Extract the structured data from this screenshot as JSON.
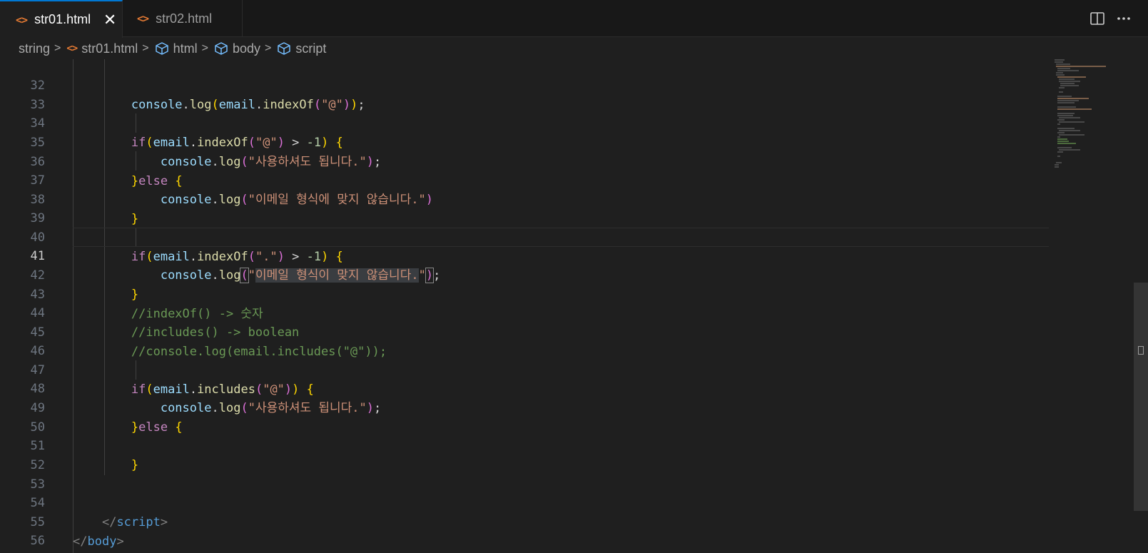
{
  "tabs": [
    {
      "label": "str01.html",
      "icon": "html-file-icon",
      "active": true
    },
    {
      "label": "str02.html",
      "icon": "html-file-icon",
      "active": false
    }
  ],
  "tab_icon_glyph": "<>",
  "close_glyph": "✕",
  "breadcrumb": {
    "folder": "string",
    "file": "str01.html",
    "symbols": [
      "html",
      "body",
      "script"
    ]
  },
  "editor": {
    "current_line": 41,
    "line_numbers": [
      32,
      33,
      34,
      35,
      36,
      37,
      38,
      39,
      40,
      41,
      42,
      43,
      44,
      45,
      46,
      47,
      48,
      49,
      50,
      51,
      52,
      53,
      54,
      55,
      56
    ],
    "strings": {
      "at": "\"@\"",
      "dot": "\".\"",
      "ok_msg": "\"사용하셔도 됩니다.\"",
      "err_msg_1": "\"이메일 형식에 맞지 않습니다.\"",
      "err_msg_2_open": "\"",
      "err_msg_2_body": "이메일 형식이 맞지 않습니다.",
      "err_msg_2_close": "\"",
      "neg_one": "-1"
    },
    "comments": {
      "c43": "//indexOf() -> 숫자",
      "c44": "//includes() -> boolean",
      "c45": "//console.log(email.includes(\"@\"));"
    },
    "keywords": {
      "if": "if",
      "else": "else"
    },
    "identifiers": {
      "console": "console",
      "log": "log",
      "email": "email",
      "indexOf": "indexOf",
      "includes": "includes"
    },
    "tags": {
      "script": "script",
      "body": "body",
      "html": "html"
    }
  },
  "colors": {
    "accent": "#0078d4",
    "editor_bg": "#1f1f1f",
    "tab_bar_bg": "#181818",
    "html_icon": "#e37933",
    "breadcrumb_symbol": "#75beff"
  }
}
